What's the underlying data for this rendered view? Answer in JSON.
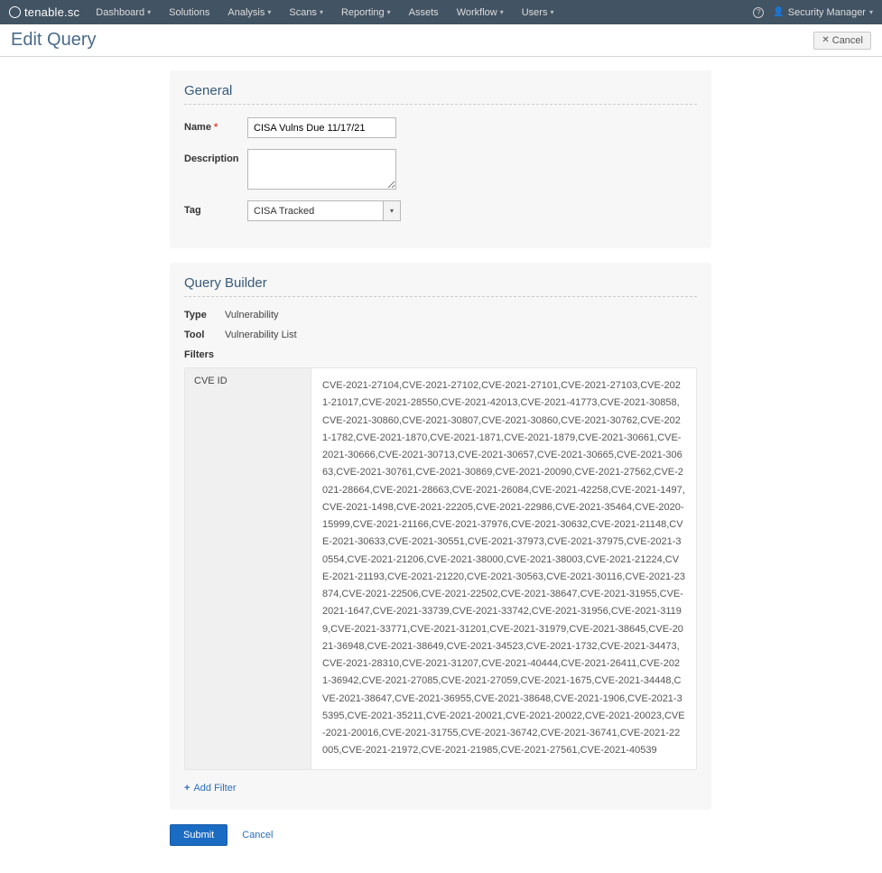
{
  "brand": "tenable.sc",
  "nav": [
    {
      "label": "Dashboard",
      "caret": true
    },
    {
      "label": "Solutions",
      "caret": false
    },
    {
      "label": "Analysis",
      "caret": true
    },
    {
      "label": "Scans",
      "caret": true
    },
    {
      "label": "Reporting",
      "caret": true
    },
    {
      "label": "Assets",
      "caret": false
    },
    {
      "label": "Workflow",
      "caret": true
    },
    {
      "label": "Users",
      "caret": true
    }
  ],
  "user_menu": "Security Manager",
  "page_title": "Edit Query",
  "cancel_button": "Cancel",
  "general": {
    "heading": "General",
    "name_label": "Name",
    "name_value": "CISA Vulns Due 11/17/21",
    "description_label": "Description",
    "description_value": "",
    "tag_label": "Tag",
    "tag_value": "CISA Tracked"
  },
  "query_builder": {
    "heading": "Query Builder",
    "type_label": "Type",
    "type_value": "Vulnerability",
    "tool_label": "Tool",
    "tool_value": "Vulnerability List",
    "filters_heading": "Filters",
    "filter_name": "CVE ID",
    "filter_value": "CVE-2021-27104,CVE-2021-27102,CVE-2021-27101,CVE-2021-27103,CVE-2021-21017,CVE-2021-28550,CVE-2021-42013,CVE-2021-41773,CVE-2021-30858,CVE-2021-30860,CVE-2021-30807,CVE-2021-30860,CVE-2021-30762,CVE-2021-1782,CVE-2021-1870,CVE-2021-1871,CVE-2021-1879,CVE-2021-30661,CVE-2021-30666,CVE-2021-30713,CVE-2021-30657,CVE-2021-30665,CVE-2021-30663,CVE-2021-30761,CVE-2021-30869,CVE-2021-20090,CVE-2021-27562,CVE-2021-28664,CVE-2021-28663,CVE-2021-26084,CVE-2021-42258,CVE-2021-1497,CVE-2021-1498,CVE-2021-22205,CVE-2021-22986,CVE-2021-35464,CVE-2020-15999,CVE-2021-21166,CVE-2021-37976,CVE-2021-30632,CVE-2021-21148,CVE-2021-30633,CVE-2021-30551,CVE-2021-37973,CVE-2021-37975,CVE-2021-30554,CVE-2021-21206,CVE-2021-38000,CVE-2021-38003,CVE-2021-21224,CVE-2021-21193,CVE-2021-21220,CVE-2021-30563,CVE-2021-30116,CVE-2021-23874,CVE-2021-22506,CVE-2021-22502,CVE-2021-38647,CVE-2021-31955,CVE-2021-1647,CVE-2021-33739,CVE-2021-33742,CVE-2021-31956,CVE-2021-31199,CVE-2021-33771,CVE-2021-31201,CVE-2021-31979,CVE-2021-38645,CVE-2021-36948,CVE-2021-38649,CVE-2021-34523,CVE-2021-1732,CVE-2021-34473,CVE-2021-28310,CVE-2021-31207,CVE-2021-40444,CVE-2021-26411,CVE-2021-36942,CVE-2021-27085,CVE-2021-27059,CVE-2021-1675,CVE-2021-34448,CVE-2021-38647,CVE-2021-36955,CVE-2021-38648,CVE-2021-1906,CVE-2021-35395,CVE-2021-35211,CVE-2021-20021,CVE-2021-20022,CVE-2021-20023,CVE-2021-20016,CVE-2021-31755,CVE-2021-36742,CVE-2021-36741,CVE-2021-22005,CVE-2021-21972,CVE-2021-21985,CVE-2021-27561,CVE-2021-40539",
    "add_filter": "Add Filter"
  },
  "actions": {
    "submit": "Submit",
    "cancel": "Cancel"
  }
}
